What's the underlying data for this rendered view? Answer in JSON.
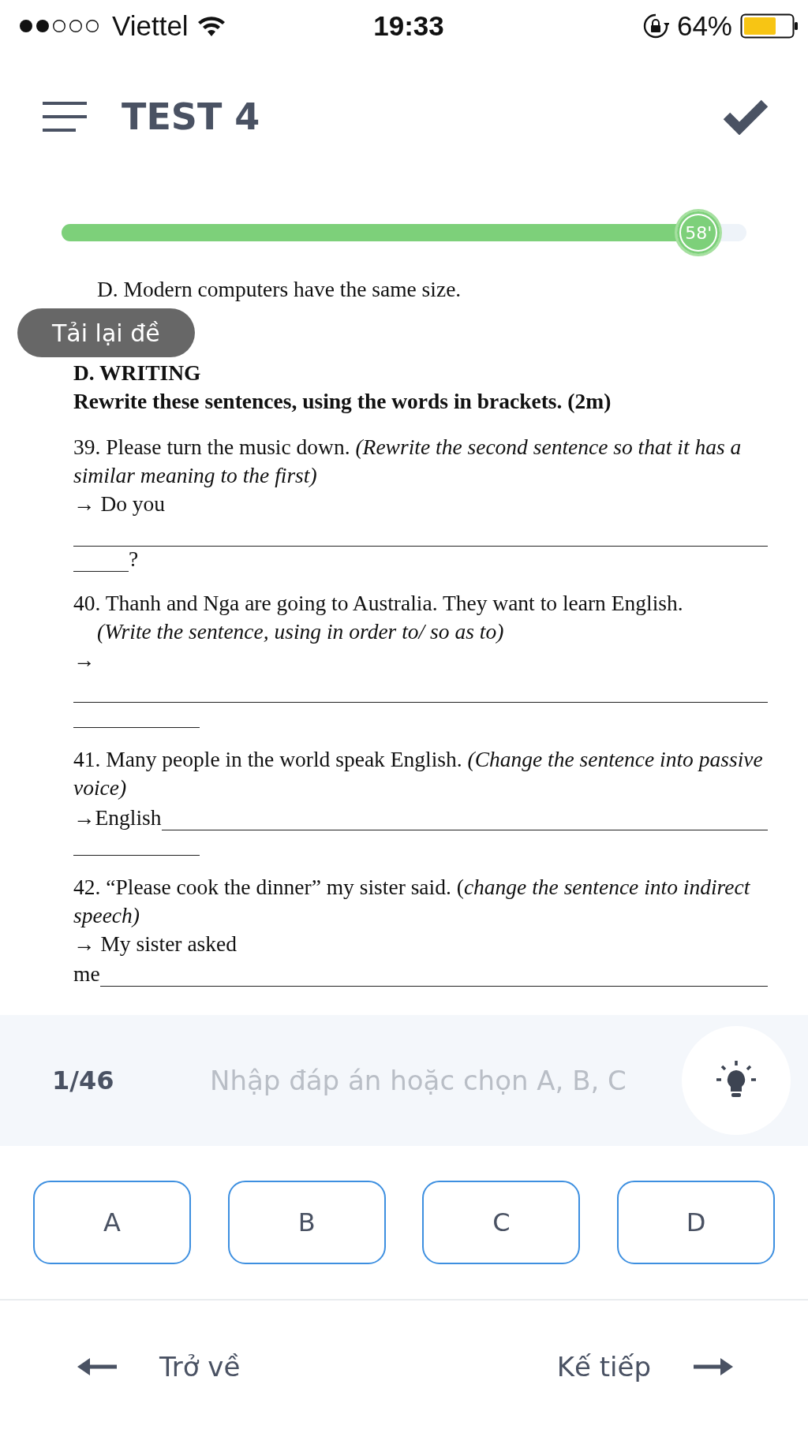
{
  "status_bar": {
    "carrier": "Viettel",
    "time": "19:33",
    "battery": "64%"
  },
  "header": {
    "title": "TEST 4"
  },
  "timer": {
    "level": 0.93,
    "label": "58'"
  },
  "document": {
    "intro": [
      {
        "kind": "option",
        "text": "D. Modern computers have the same size."
      },
      {
        "kind": "heading",
        "text": "D. WRITING"
      },
      {
        "kind": "heading",
        "text": "Rewrite these sentences, using the words in brackets. (2m)"
      }
    ],
    "questions": [
      {
        "lines": [
          {
            "kind": "para",
            "text": "39. Please turn the music down. *(Rewrite the second sentence so that it has a similar meaning to the first)*"
          },
          {
            "kind": "para",
            "text": "→ Do you"
          },
          {
            "kind": "line-full"
          },
          {
            "kind": "line-short",
            "after": "?"
          }
        ]
      },
      {
        "lines": [
          {
            "kind": "para",
            "text": "40. Thanh and Nga are going to Australia. They want to learn English."
          },
          {
            "kind": "note",
            "text": "(Write the sentence, using in order to/ so as to)"
          },
          {
            "kind": "para",
            "text": "→"
          },
          {
            "kind": "line-full"
          },
          {
            "kind": "line-short"
          }
        ]
      },
      {
        "lines": [
          {
            "kind": "para",
            "text": "41. Many people in the world speak English. *(Change the sentence into passive voice)*"
          },
          {
            "kind": "line-full",
            "before": "→English"
          },
          {
            "kind": "line-short"
          }
        ]
      },
      {
        "lines": [
          {
            "kind": "para",
            "text": "42. “Please cook the dinner” my sister said. (*change the sentence into indirect speech)*"
          },
          {
            "kind": "para",
            "text": "→ My sister asked"
          },
          {
            "kind": "line-full",
            "before": "me"
          }
        ]
      }
    ]
  },
  "toast": {
    "text": "Tải lại đề"
  },
  "answer_bar": {
    "counter": "1/46",
    "placeholder": "Nhập đáp án hoặc chọn A, B, C"
  },
  "choices": [
    {
      "label": "A",
      "selected": false
    },
    {
      "label": "B",
      "selected": false
    },
    {
      "label": "C",
      "selected": false
    },
    {
      "label": "D",
      "selected": false
    }
  ],
  "nav": {
    "back": "Trở về",
    "next": "Kế tiếp"
  }
}
